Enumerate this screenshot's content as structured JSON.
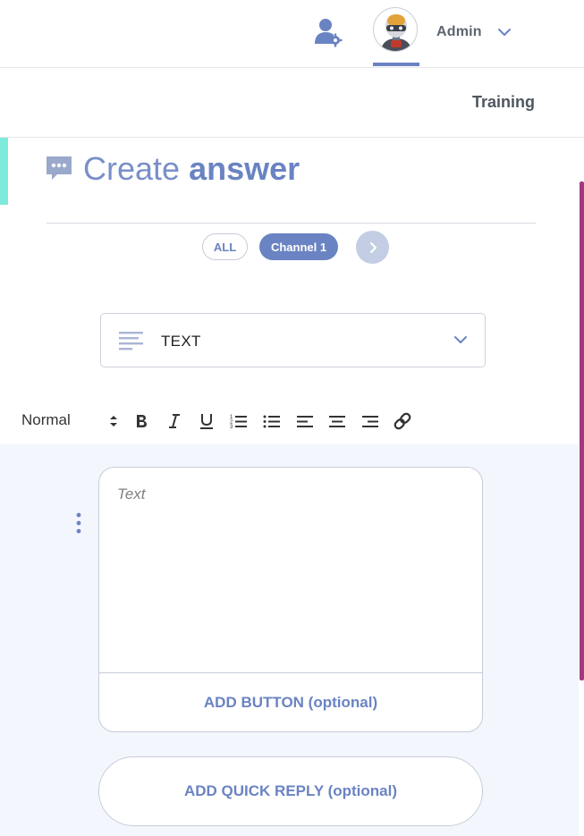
{
  "header": {
    "user_name": "Admin"
  },
  "subheader": {
    "training_label": "Training"
  },
  "page": {
    "title_light": "Create ",
    "title_bold": "answer"
  },
  "channels": {
    "all_label": "ALL",
    "active_label": "Channel 1"
  },
  "answer_type": {
    "selected": "TEXT"
  },
  "toolbar": {
    "format_label": "Normal"
  },
  "editor": {
    "text_placeholder": "Text",
    "add_button_label": "ADD BUTTON (optional)",
    "add_quick_reply_label": "ADD QUICK REPLY (optional)"
  },
  "colors": {
    "accent": "#6a83c2",
    "teal_accent": "#7eeadb",
    "scroll_accent": "#a23a80",
    "editor_bg": "#f3f6fc"
  },
  "icons": [
    "user-settings-icon",
    "robot-avatar-icon",
    "chevron-down-icon",
    "chat-bubble-icon",
    "chevron-right-icon",
    "text-lines-icon",
    "bold-icon",
    "italic-icon",
    "underline-icon",
    "ordered-list-icon",
    "bullet-list-icon",
    "align-left-icon",
    "align-center-icon",
    "align-right-icon",
    "link-icon",
    "vertical-dots-icon"
  ]
}
